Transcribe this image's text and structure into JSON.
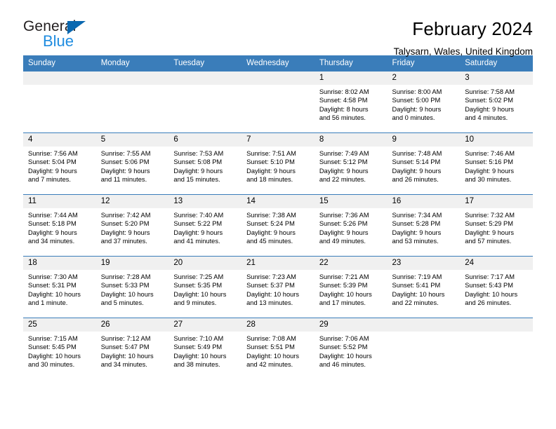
{
  "logo": {
    "word_top": "General",
    "word_bottom": "Blue",
    "triangle_color": "#0a68b0",
    "blue_text_color": "#1f8ce0"
  },
  "header": {
    "title": "February 2024",
    "subtitle": "Talysarn, Wales, United Kingdom",
    "header_bg": "#3a7dba",
    "daynum_bg": "#f0f0f0"
  },
  "weekdays": [
    "Sunday",
    "Monday",
    "Tuesday",
    "Wednesday",
    "Thursday",
    "Friday",
    "Saturday"
  ],
  "weeks": [
    [
      {
        "day": "",
        "blank": true
      },
      {
        "day": "",
        "blank": true
      },
      {
        "day": "",
        "blank": true
      },
      {
        "day": "",
        "blank": true
      },
      {
        "day": "1",
        "sunrise": "Sunrise: 8:02 AM",
        "sunset": "Sunset: 4:58 PM",
        "daylight1": "Daylight: 8 hours",
        "daylight2": "and 56 minutes."
      },
      {
        "day": "2",
        "sunrise": "Sunrise: 8:00 AM",
        "sunset": "Sunset: 5:00 PM",
        "daylight1": "Daylight: 9 hours",
        "daylight2": "and 0 minutes."
      },
      {
        "day": "3",
        "sunrise": "Sunrise: 7:58 AM",
        "sunset": "Sunset: 5:02 PM",
        "daylight1": "Daylight: 9 hours",
        "daylight2": "and 4 minutes."
      }
    ],
    [
      {
        "day": "4",
        "sunrise": "Sunrise: 7:56 AM",
        "sunset": "Sunset: 5:04 PM",
        "daylight1": "Daylight: 9 hours",
        "daylight2": "and 7 minutes."
      },
      {
        "day": "5",
        "sunrise": "Sunrise: 7:55 AM",
        "sunset": "Sunset: 5:06 PM",
        "daylight1": "Daylight: 9 hours",
        "daylight2": "and 11 minutes."
      },
      {
        "day": "6",
        "sunrise": "Sunrise: 7:53 AM",
        "sunset": "Sunset: 5:08 PM",
        "daylight1": "Daylight: 9 hours",
        "daylight2": "and 15 minutes."
      },
      {
        "day": "7",
        "sunrise": "Sunrise: 7:51 AM",
        "sunset": "Sunset: 5:10 PM",
        "daylight1": "Daylight: 9 hours",
        "daylight2": "and 18 minutes."
      },
      {
        "day": "8",
        "sunrise": "Sunrise: 7:49 AM",
        "sunset": "Sunset: 5:12 PM",
        "daylight1": "Daylight: 9 hours",
        "daylight2": "and 22 minutes."
      },
      {
        "day": "9",
        "sunrise": "Sunrise: 7:48 AM",
        "sunset": "Sunset: 5:14 PM",
        "daylight1": "Daylight: 9 hours",
        "daylight2": "and 26 minutes."
      },
      {
        "day": "10",
        "sunrise": "Sunrise: 7:46 AM",
        "sunset": "Sunset: 5:16 PM",
        "daylight1": "Daylight: 9 hours",
        "daylight2": "and 30 minutes."
      }
    ],
    [
      {
        "day": "11",
        "sunrise": "Sunrise: 7:44 AM",
        "sunset": "Sunset: 5:18 PM",
        "daylight1": "Daylight: 9 hours",
        "daylight2": "and 34 minutes."
      },
      {
        "day": "12",
        "sunrise": "Sunrise: 7:42 AM",
        "sunset": "Sunset: 5:20 PM",
        "daylight1": "Daylight: 9 hours",
        "daylight2": "and 37 minutes."
      },
      {
        "day": "13",
        "sunrise": "Sunrise: 7:40 AM",
        "sunset": "Sunset: 5:22 PM",
        "daylight1": "Daylight: 9 hours",
        "daylight2": "and 41 minutes."
      },
      {
        "day": "14",
        "sunrise": "Sunrise: 7:38 AM",
        "sunset": "Sunset: 5:24 PM",
        "daylight1": "Daylight: 9 hours",
        "daylight2": "and 45 minutes."
      },
      {
        "day": "15",
        "sunrise": "Sunrise: 7:36 AM",
        "sunset": "Sunset: 5:26 PM",
        "daylight1": "Daylight: 9 hours",
        "daylight2": "and 49 minutes."
      },
      {
        "day": "16",
        "sunrise": "Sunrise: 7:34 AM",
        "sunset": "Sunset: 5:28 PM",
        "daylight1": "Daylight: 9 hours",
        "daylight2": "and 53 minutes."
      },
      {
        "day": "17",
        "sunrise": "Sunrise: 7:32 AM",
        "sunset": "Sunset: 5:29 PM",
        "daylight1": "Daylight: 9 hours",
        "daylight2": "and 57 minutes."
      }
    ],
    [
      {
        "day": "18",
        "sunrise": "Sunrise: 7:30 AM",
        "sunset": "Sunset: 5:31 PM",
        "daylight1": "Daylight: 10 hours",
        "daylight2": "and 1 minute."
      },
      {
        "day": "19",
        "sunrise": "Sunrise: 7:28 AM",
        "sunset": "Sunset: 5:33 PM",
        "daylight1": "Daylight: 10 hours",
        "daylight2": "and 5 minutes."
      },
      {
        "day": "20",
        "sunrise": "Sunrise: 7:25 AM",
        "sunset": "Sunset: 5:35 PM",
        "daylight1": "Daylight: 10 hours",
        "daylight2": "and 9 minutes."
      },
      {
        "day": "21",
        "sunrise": "Sunrise: 7:23 AM",
        "sunset": "Sunset: 5:37 PM",
        "daylight1": "Daylight: 10 hours",
        "daylight2": "and 13 minutes."
      },
      {
        "day": "22",
        "sunrise": "Sunrise: 7:21 AM",
        "sunset": "Sunset: 5:39 PM",
        "daylight1": "Daylight: 10 hours",
        "daylight2": "and 17 minutes."
      },
      {
        "day": "23",
        "sunrise": "Sunrise: 7:19 AM",
        "sunset": "Sunset: 5:41 PM",
        "daylight1": "Daylight: 10 hours",
        "daylight2": "and 22 minutes."
      },
      {
        "day": "24",
        "sunrise": "Sunrise: 7:17 AM",
        "sunset": "Sunset: 5:43 PM",
        "daylight1": "Daylight: 10 hours",
        "daylight2": "and 26 minutes."
      }
    ],
    [
      {
        "day": "25",
        "sunrise": "Sunrise: 7:15 AM",
        "sunset": "Sunset: 5:45 PM",
        "daylight1": "Daylight: 10 hours",
        "daylight2": "and 30 minutes."
      },
      {
        "day": "26",
        "sunrise": "Sunrise: 7:12 AM",
        "sunset": "Sunset: 5:47 PM",
        "daylight1": "Daylight: 10 hours",
        "daylight2": "and 34 minutes."
      },
      {
        "day": "27",
        "sunrise": "Sunrise: 7:10 AM",
        "sunset": "Sunset: 5:49 PM",
        "daylight1": "Daylight: 10 hours",
        "daylight2": "and 38 minutes."
      },
      {
        "day": "28",
        "sunrise": "Sunrise: 7:08 AM",
        "sunset": "Sunset: 5:51 PM",
        "daylight1": "Daylight: 10 hours",
        "daylight2": "and 42 minutes."
      },
      {
        "day": "29",
        "sunrise": "Sunrise: 7:06 AM",
        "sunset": "Sunset: 5:52 PM",
        "daylight1": "Daylight: 10 hours",
        "daylight2": "and 46 minutes."
      },
      {
        "day": "",
        "blank": true
      },
      {
        "day": "",
        "blank": true
      }
    ]
  ]
}
